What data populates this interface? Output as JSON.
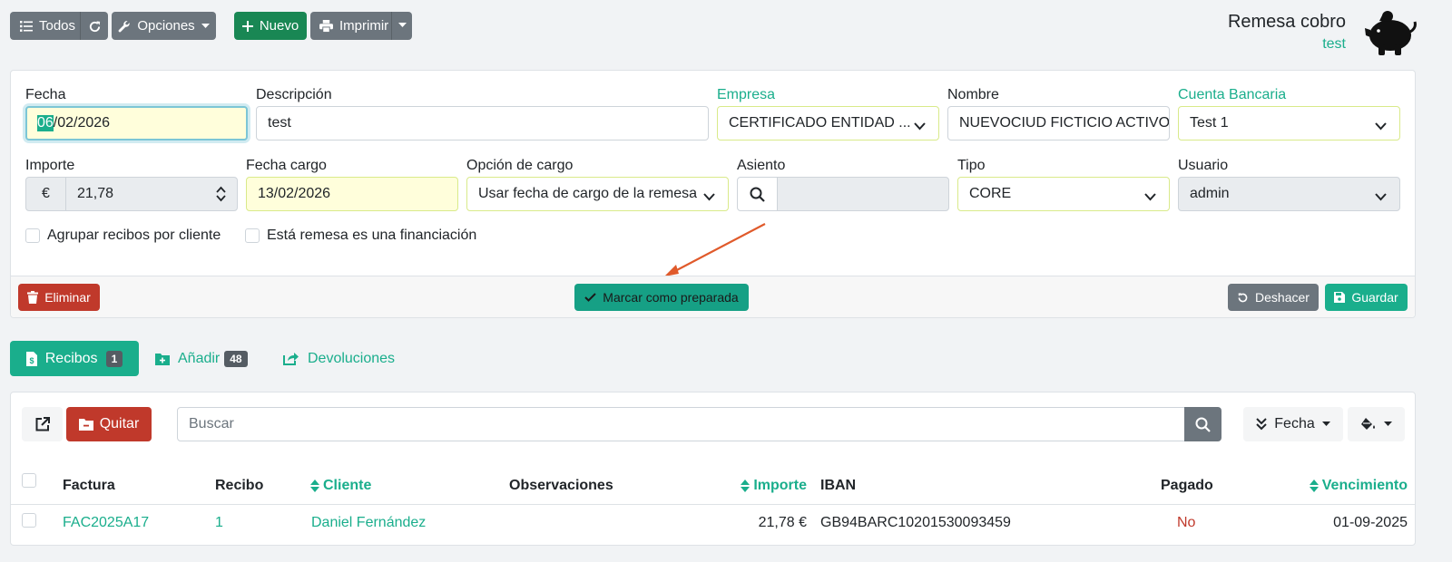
{
  "toolbar": {
    "todos_label": "Todos",
    "opciones_label": "Opciones",
    "nuevo_label": "Nuevo",
    "imprimir_label": "Imprimir"
  },
  "header": {
    "title": "Remesa cobro",
    "subtitle": "test"
  },
  "form": {
    "fecha": {
      "label": "Fecha",
      "value_highlight": "06",
      "value_rest": "/02/2026"
    },
    "descripcion": {
      "label": "Descripción",
      "value": "test"
    },
    "empresa": {
      "label": "Empresa",
      "value": "CERTIFICADO ENTIDAD ..."
    },
    "nombre": {
      "label": "Nombre",
      "value": "NUEVOCIUD FICTICIO ACTIVO"
    },
    "cuenta": {
      "label": "Cuenta Bancaria",
      "value": "Test 1"
    },
    "importe": {
      "label": "Importe",
      "currency": "€",
      "value": "21,78"
    },
    "fecha_cargo": {
      "label": "Fecha cargo",
      "value": "13/02/2026"
    },
    "opcion_cargo": {
      "label": "Opción de cargo",
      "value": "Usar fecha de cargo de la remesa"
    },
    "asiento": {
      "label": "Asiento",
      "value": ""
    },
    "tipo": {
      "label": "Tipo",
      "value": "CORE"
    },
    "usuario": {
      "label": "Usuario",
      "value": "admin"
    },
    "agrupar_label": "Agrupar recibos por cliente",
    "financiacion_label": "Está remesa es una financiación"
  },
  "actions": {
    "eliminar": "Eliminar",
    "marcar": "Marcar como preparada",
    "deshacer": "Deshacer",
    "guardar": "Guardar"
  },
  "tabs": [
    {
      "label": "Recibos",
      "count": "1"
    },
    {
      "label": "Añadir",
      "count": "48"
    },
    {
      "label": "Devoluciones"
    }
  ],
  "list": {
    "quitar_label": "Quitar",
    "search_placeholder": "Buscar",
    "sort_label": "Fecha",
    "columns": {
      "factura": "Factura",
      "recibo": "Recibo",
      "cliente": "Cliente",
      "observaciones": "Observaciones",
      "importe": "Importe",
      "iban": "IBAN",
      "pagado": "Pagado",
      "vencimiento": "Vencimiento"
    },
    "rows": [
      {
        "factura": "FAC2025A17",
        "recibo": "1",
        "cliente": "Daniel Fernández",
        "observaciones": "",
        "importe": "21,78 €",
        "iban": "GB94BARC10201530093459",
        "pagado": "No",
        "vencimiento": "01-09-2025"
      }
    ]
  },
  "colors": {
    "accent": "#1aae8c",
    "danger": "#c0392b",
    "secondary": "#6c757d",
    "success": "#198754",
    "annotation_arrow": "#e05a2b"
  }
}
